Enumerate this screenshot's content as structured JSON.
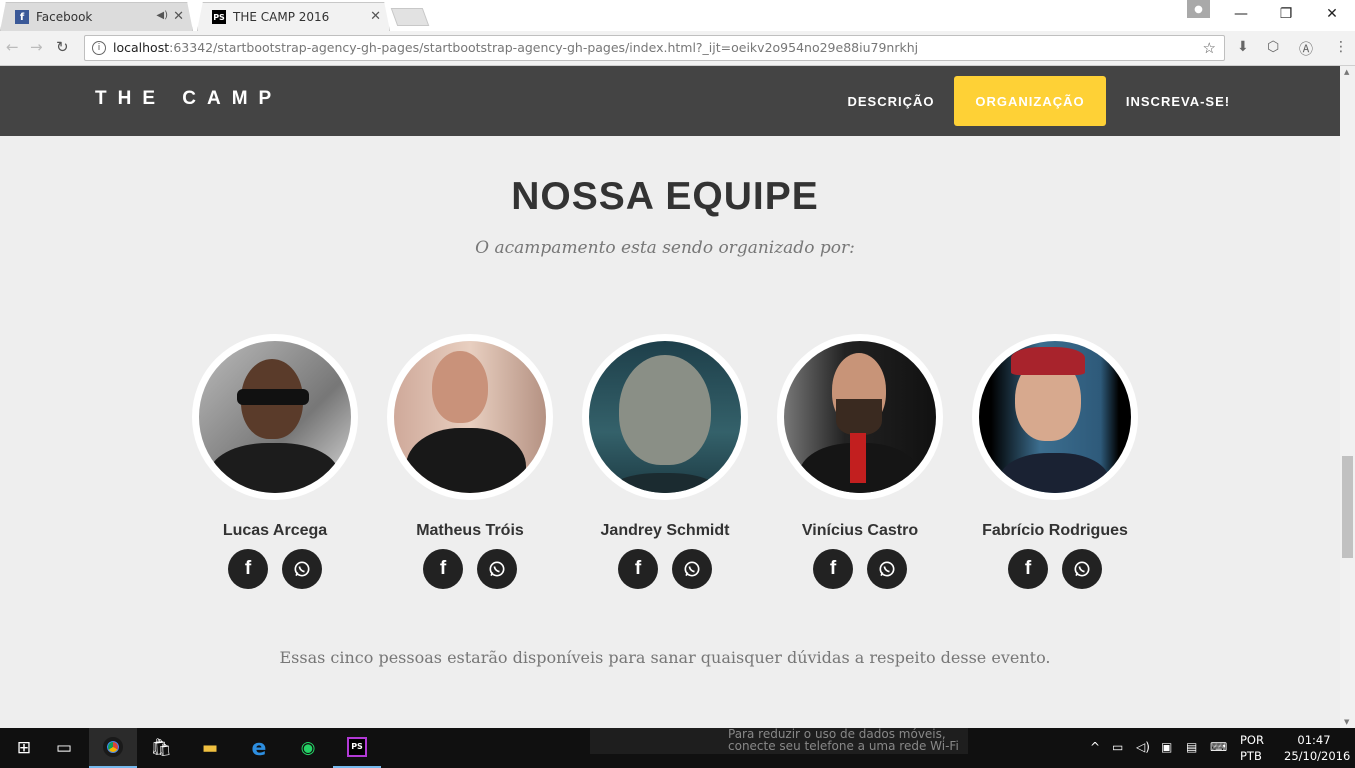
{
  "browser": {
    "tabs": [
      {
        "title": "Facebook",
        "favicon": "facebook-icon",
        "active": false,
        "audio": true
      },
      {
        "title": "THE CAMP 2016",
        "favicon": "phpstorm-icon",
        "active": true,
        "audio": false
      }
    ],
    "url": {
      "host": "localhost",
      "path": ":63342/startbootstrap-agency-gh-pages/startbootstrap-agency-gh-pages/index.html?_ijt=oeikv2o954no29e88iu79nrkhj"
    }
  },
  "site": {
    "brand": "THE CAMP",
    "nav": [
      {
        "label": "DESCRIÇÃO",
        "active": false
      },
      {
        "label": "ORGANIZAÇÃO",
        "active": true
      },
      {
        "label": "INSCREVA-SE!",
        "active": false
      }
    ],
    "accent_color": "#fed136",
    "navbar_color": "#444444"
  },
  "team": {
    "heading": "NOSSA EQUIPE",
    "subheading": "O acampamento esta sendo organizado por:",
    "members": [
      {
        "name": "Lucas Arcega"
      },
      {
        "name": "Matheus Tróis"
      },
      {
        "name": "Jandrey Schmidt"
      },
      {
        "name": "Vinícius Castro"
      },
      {
        "name": "Fabrício Rodrigues"
      }
    ],
    "social_icons": [
      "facebook-icon",
      "whatsapp-icon"
    ],
    "footnote": "Essas cinco pessoas estarão disponíveis para sanar quaisquer dúvidas a respeito desse evento."
  },
  "taskbar": {
    "notification": "Para reduzir o uso de dados móveis, conecte seu telefone a uma rede Wi-Fi",
    "lang_line1": "POR",
    "lang_line2": "PTB",
    "time": "01:47",
    "date": "25/10/2016"
  }
}
